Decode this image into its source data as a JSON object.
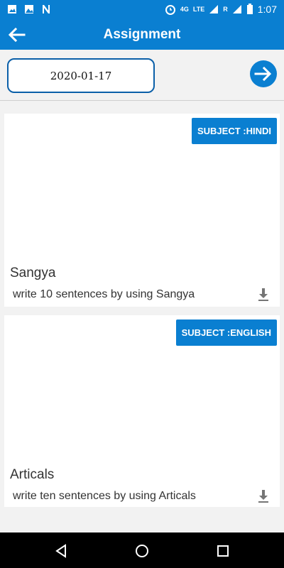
{
  "status": {
    "time": "1:07",
    "network_label": "LTE",
    "network_small": "4G",
    "roaming_label": "R"
  },
  "toolbar": {
    "title": "Assignment"
  },
  "date_filter": {
    "value": "2020-01-17"
  },
  "assignments": [
    {
      "subject_label": "SUBJECT :HINDI",
      "title": "Sangya",
      "description": "write 10 sentences by using Sangya"
    },
    {
      "subject_label": "SUBJECT :ENGLISH",
      "title": "Articals",
      "description": "write ten sentences by using Articals"
    }
  ],
  "icons": {
    "status_left": [
      "image-icon",
      "photo-icon",
      "n-app-icon"
    ],
    "status_right": [
      "alarm-icon",
      "signal-icon",
      "battery-icon"
    ],
    "nav": [
      "back-triangle-icon",
      "home-circle-icon",
      "recent-square-icon"
    ]
  },
  "colors": {
    "primary": "#0a7fd1",
    "border": "#0a5fa8",
    "nav_bg": "#000000"
  }
}
